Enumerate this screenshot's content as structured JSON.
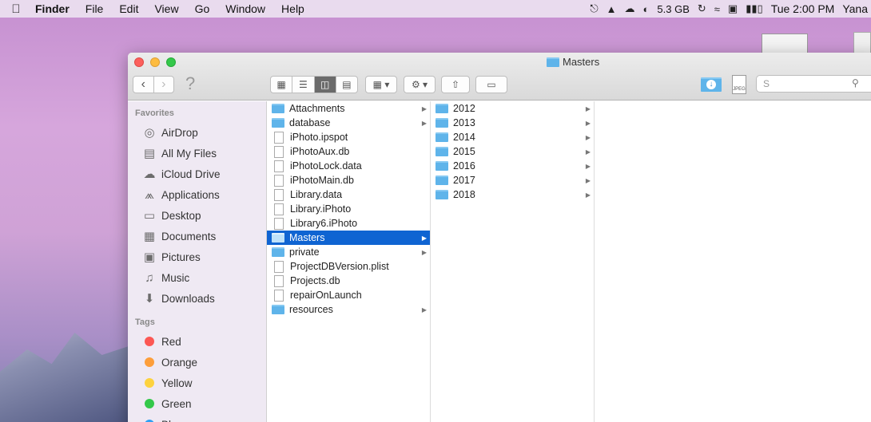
{
  "menubar": {
    "app": "Finder",
    "items": [
      "File",
      "Edit",
      "View",
      "Go",
      "Window",
      "Help"
    ],
    "memory": "5.3 GB",
    "clock": "Tue 2:00 PM",
    "user": "Yana"
  },
  "window": {
    "title": "Masters",
    "search_placeholder": "S",
    "jpeg_label": "JPEG"
  },
  "sidebar": {
    "favorites_label": "Favorites",
    "favorites": [
      {
        "label": "AirDrop",
        "icon": "airdrop-icon"
      },
      {
        "label": "All My Files",
        "icon": "all-files-icon"
      },
      {
        "label": "iCloud Drive",
        "icon": "cloud-icon"
      },
      {
        "label": "Applications",
        "icon": "applications-icon"
      },
      {
        "label": "Desktop",
        "icon": "desktop-icon"
      },
      {
        "label": "Documents",
        "icon": "documents-icon"
      },
      {
        "label": "Pictures",
        "icon": "camera-icon"
      },
      {
        "label": "Music",
        "icon": "music-icon"
      },
      {
        "label": "Downloads",
        "icon": "download-icon"
      }
    ],
    "tags_label": "Tags",
    "tags": [
      {
        "label": "Red",
        "color": "#fc5753"
      },
      {
        "label": "Orange",
        "color": "#fd9e3a"
      },
      {
        "label": "Yellow",
        "color": "#fdd23e"
      },
      {
        "label": "Green",
        "color": "#34c84a"
      },
      {
        "label": "Blue",
        "color": "#2fa0f4"
      }
    ]
  },
  "columns": {
    "col1": [
      {
        "name": "Attachments",
        "kind": "folder"
      },
      {
        "name": "database",
        "kind": "folder"
      },
      {
        "name": "iPhoto.ipspot",
        "kind": "file"
      },
      {
        "name": "iPhotoAux.db",
        "kind": "file"
      },
      {
        "name": "iPhotoLock.data",
        "kind": "file"
      },
      {
        "name": "iPhotoMain.db",
        "kind": "file"
      },
      {
        "name": "Library.data",
        "kind": "file"
      },
      {
        "name": "Library.iPhoto",
        "kind": "file"
      },
      {
        "name": "Library6.iPhoto",
        "kind": "file"
      },
      {
        "name": "Masters",
        "kind": "folder",
        "selected": true
      },
      {
        "name": "private",
        "kind": "folder"
      },
      {
        "name": "ProjectDBVersion.plist",
        "kind": "file"
      },
      {
        "name": "Projects.db",
        "kind": "file"
      },
      {
        "name": "repairOnLaunch",
        "kind": "file"
      },
      {
        "name": "resources",
        "kind": "folder"
      }
    ],
    "col2": [
      {
        "name": "2012",
        "kind": "folder"
      },
      {
        "name": "2013",
        "kind": "folder"
      },
      {
        "name": "2014",
        "kind": "folder"
      },
      {
        "name": "2015",
        "kind": "folder"
      },
      {
        "name": "2016",
        "kind": "folder"
      },
      {
        "name": "2017",
        "kind": "folder"
      },
      {
        "name": "2018",
        "kind": "folder"
      }
    ]
  }
}
